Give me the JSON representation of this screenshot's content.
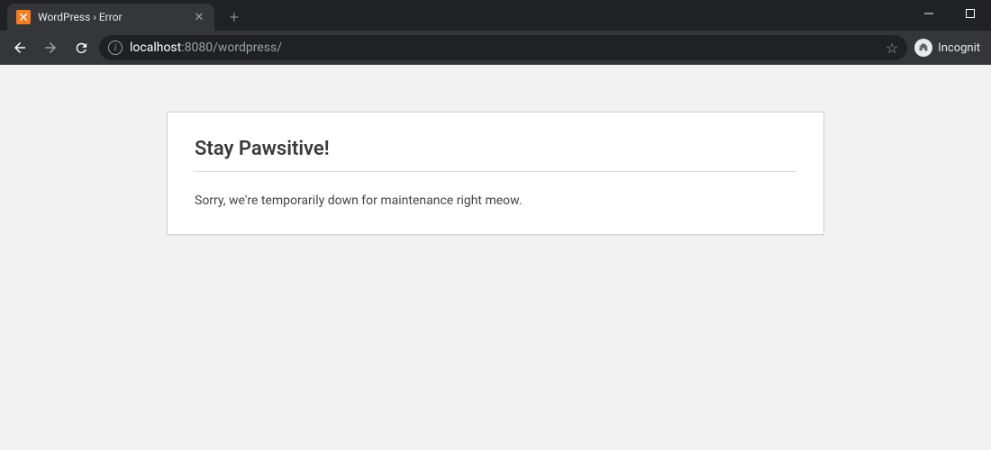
{
  "browser": {
    "tab": {
      "title": "WordPress › Error"
    },
    "address": {
      "host": "localhost",
      "port_path": ":8080/wordpress/"
    },
    "incognito_label": "Incognit"
  },
  "page": {
    "heading": "Stay Pawsitive!",
    "body": "Sorry, we're temporarily down for maintenance right meow."
  }
}
